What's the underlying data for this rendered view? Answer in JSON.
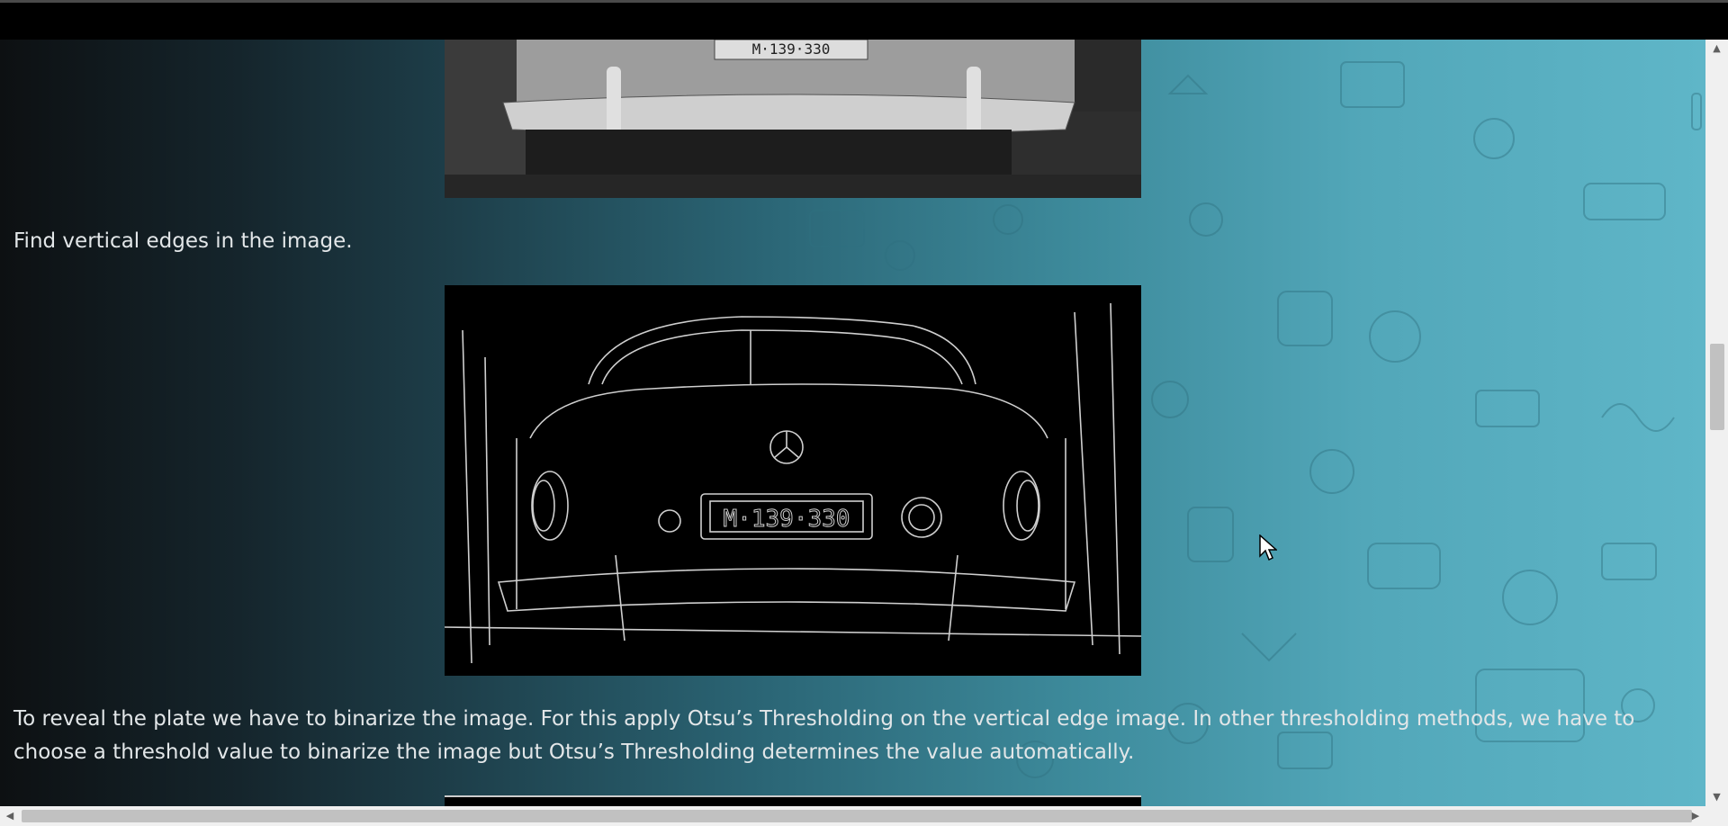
{
  "content": {
    "caption_vertical_edges": "Find vertical edges in the image.",
    "paragraph_binarize": "To reveal the plate we have to binarize the image. For this apply Otsu’s Thresholding on the vertical edge image. In other thresholding methods, we have to choose a threshold value to binarize the image but Otsu’s Thresholding determines the value automatically.",
    "plate_text": "M·139·330"
  },
  "scrollbars": {
    "up_arrow": "▲",
    "down_arrow": "▼",
    "left_arrow": "◀",
    "right_arrow": "▶"
  },
  "icons": {
    "cursor": "arrow-cursor-icon"
  },
  "colors": {
    "gradient_left": "#0d1012",
    "gradient_right": "#5fb6c8",
    "text": "#e2e6e8"
  }
}
